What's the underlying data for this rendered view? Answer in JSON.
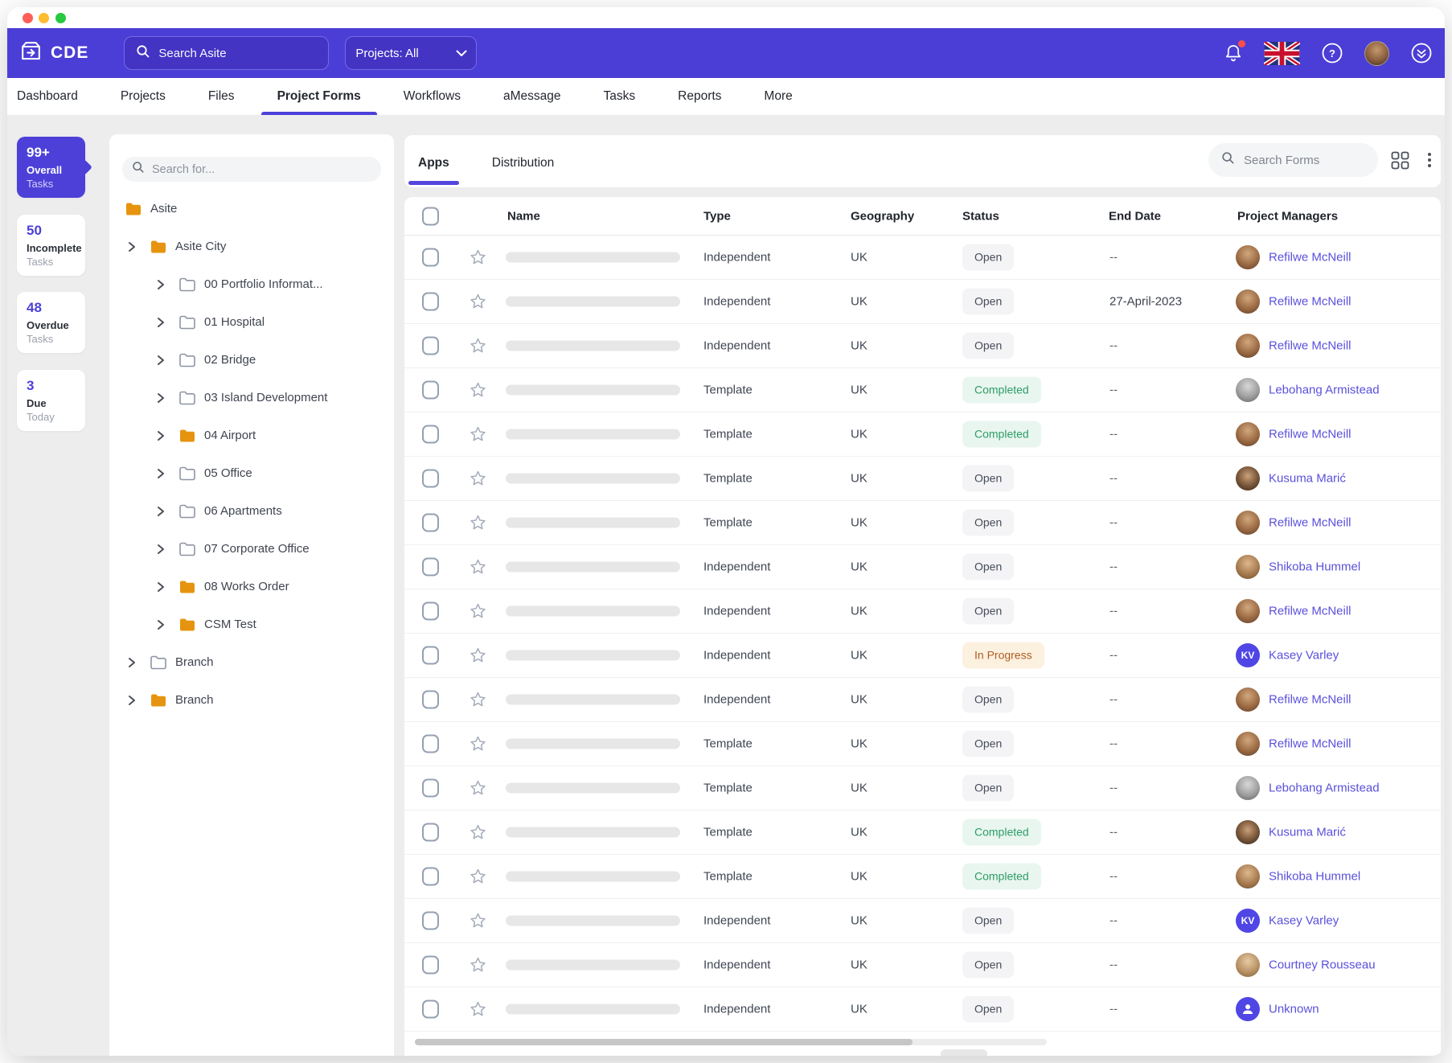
{
  "colors": {
    "accent": "#4c40d9",
    "topbar": "#4b3ed6",
    "link": "#5a50db",
    "folder_orange": "#e6940f",
    "status_open": {
      "bg": "#f4f4f6",
      "text": "#464c5a"
    },
    "status_completed": {
      "bg": "#e9f6ef",
      "text": "#2d9c66"
    },
    "status_in_progress": {
      "bg": "#fcf1df",
      "text": "#ad5d25"
    }
  },
  "icons": {
    "topbar": [
      "search-icon",
      "chevron-down-icon",
      "bell-icon",
      "uk-flag-icon",
      "help-icon",
      "user-avatar",
      "double-chevron-down-icon"
    ],
    "content": [
      "magnifier-icon",
      "grid-view-icon",
      "kebab-icon",
      "star-icon",
      "checkbox",
      "folder-icon",
      "chevron-right-icon",
      "person-icon"
    ]
  },
  "topbar": {
    "logo": "CDE",
    "search_placeholder": "Search Asite",
    "projects_filter": "Projects: All"
  },
  "nav": {
    "items": [
      "Dashboard",
      "Projects",
      "Files",
      "Project Forms",
      "Workflows",
      "aMessage",
      "Tasks",
      "Reports",
      "More"
    ],
    "active_index": 3
  },
  "task_summary": {
    "cards": [
      {
        "count": "99+",
        "label": "Overall",
        "sublabel": "Tasks",
        "active": true
      },
      {
        "count": "50",
        "label": "Incomplete",
        "sublabel": "Tasks",
        "active": false
      },
      {
        "count": "48",
        "label": "Overdue",
        "sublabel": "Tasks",
        "active": false
      },
      {
        "count": "3",
        "label": "Due",
        "sublabel": "Today",
        "active": false
      }
    ]
  },
  "tree": {
    "search_placeholder": "Search for...",
    "items": [
      {
        "label": "Asite",
        "indent": "root",
        "chevron": false,
        "folder": "orange"
      },
      {
        "label": "Asite City",
        "indent": "l0",
        "chevron": true,
        "folder": "orange"
      },
      {
        "label": "00 Portfolio Informat...",
        "indent": "l1",
        "chevron": true,
        "folder": "outline"
      },
      {
        "label": "01 Hospital",
        "indent": "l1",
        "chevron": true,
        "folder": "outline"
      },
      {
        "label": "02 Bridge",
        "indent": "l1",
        "chevron": true,
        "folder": "outline"
      },
      {
        "label": "03 Island Development",
        "indent": "l1",
        "chevron": true,
        "folder": "outline"
      },
      {
        "label": "04 Airport",
        "indent": "l1",
        "chevron": true,
        "folder": "orange"
      },
      {
        "label": "05 Office",
        "indent": "l1",
        "chevron": true,
        "folder": "outline"
      },
      {
        "label": "06 Apartments",
        "indent": "l1",
        "chevron": true,
        "folder": "outline"
      },
      {
        "label": "07 Corporate Office",
        "indent": "l1",
        "chevron": true,
        "folder": "outline"
      },
      {
        "label": "08 Works Order",
        "indent": "l1",
        "chevron": true,
        "folder": "orange"
      },
      {
        "label": "CSM Test",
        "indent": "l1",
        "chevron": true,
        "folder": "orange"
      },
      {
        "label": "Branch",
        "indent": "l0",
        "chevron": true,
        "folder": "outline"
      },
      {
        "label": "Branch",
        "indent": "l0",
        "chevron": true,
        "folder": "orange"
      }
    ]
  },
  "forms": {
    "tabs": [
      {
        "label": "Apps",
        "active": true
      },
      {
        "label": "Distribution",
        "active": false
      }
    ],
    "search_placeholder": "Search Forms",
    "table": {
      "columns": [
        "Name",
        "Type",
        "Geography",
        "Status",
        "End Date",
        "Project Managers"
      ],
      "rows": [
        {
          "type": "Independent",
          "geography": "UK",
          "status": "Open",
          "end_date": "--",
          "manager": "Refilwe McNeill",
          "avatar": "refilwe"
        },
        {
          "type": "Independent",
          "geography": "UK",
          "status": "Open",
          "end_date": "27-April-2023",
          "manager": "Refilwe McNeill",
          "avatar": "refilwe"
        },
        {
          "type": "Independent",
          "geography": "UK",
          "status": "Open",
          "end_date": "--",
          "manager": "Refilwe McNeill",
          "avatar": "refilwe"
        },
        {
          "type": "Template",
          "geography": "UK",
          "status": "Completed",
          "end_date": "--",
          "manager": "Lebohang Armistead",
          "avatar": "lebohang"
        },
        {
          "type": "Template",
          "geography": "UK",
          "status": "Completed",
          "end_date": "--",
          "manager": "Refilwe McNeill",
          "avatar": "refilwe"
        },
        {
          "type": "Template",
          "geography": "UK",
          "status": "Open",
          "end_date": "--",
          "manager": "Kusuma Marić",
          "avatar": "kusuma"
        },
        {
          "type": "Template",
          "geography": "UK",
          "status": "Open",
          "end_date": "--",
          "manager": "Refilwe McNeill",
          "avatar": "refilwe"
        },
        {
          "type": "Independent",
          "geography": "UK",
          "status": "Open",
          "end_date": "--",
          "manager": "Shikoba Hummel",
          "avatar": "shikoba"
        },
        {
          "type": "Independent",
          "geography": "UK",
          "status": "Open",
          "end_date": "--",
          "manager": "Refilwe McNeill",
          "avatar": "refilwe"
        },
        {
          "type": "Independent",
          "geography": "UK",
          "status": "In Progress",
          "end_date": "--",
          "manager": "Kasey Varley",
          "avatar": "initials",
          "avatar_initials": "KV"
        },
        {
          "type": "Independent",
          "geography": "UK",
          "status": "Open",
          "end_date": "--",
          "manager": "Refilwe McNeill",
          "avatar": "refilwe"
        },
        {
          "type": "Template",
          "geography": "UK",
          "status": "Open",
          "end_date": "--",
          "manager": "Refilwe McNeill",
          "avatar": "refilwe"
        },
        {
          "type": "Template",
          "geography": "UK",
          "status": "Open",
          "end_date": "--",
          "manager": "Lebohang Armistead",
          "avatar": "lebohang"
        },
        {
          "type": "Template",
          "geography": "UK",
          "status": "Completed",
          "end_date": "--",
          "manager": "Kusuma Marić",
          "avatar": "kusuma"
        },
        {
          "type": "Template",
          "geography": "UK",
          "status": "Completed",
          "end_date": "--",
          "manager": "Shikoba Hummel",
          "avatar": "shikoba"
        },
        {
          "type": "Independent",
          "geography": "UK",
          "status": "Open",
          "end_date": "--",
          "manager": "Kasey Varley",
          "avatar": "initials",
          "avatar_initials": "KV"
        },
        {
          "type": "Independent",
          "geography": "UK",
          "status": "Open",
          "end_date": "--",
          "manager": "Courtney Rousseau",
          "avatar": "courtney"
        },
        {
          "type": "Independent",
          "geography": "UK",
          "status": "Open",
          "end_date": "--",
          "manager": "Unknown",
          "avatar": "unknown"
        }
      ]
    }
  }
}
